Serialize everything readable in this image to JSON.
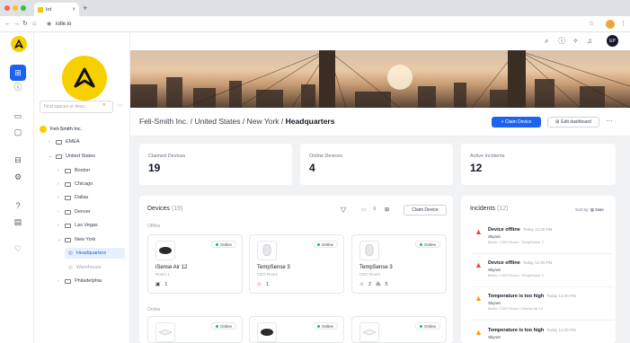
{
  "browser": {
    "tab_title": "Iot",
    "tab_close": "×",
    "new_tab": "+",
    "url": "iotle.io"
  },
  "topbar": {
    "avatar_initials": "EP"
  },
  "tree": {
    "search_placeholder": "Find spaces or devic...",
    "root": "Feli-Smith Inc.",
    "items": [
      {
        "label": "EMEA",
        "level": 1
      },
      {
        "label": "United States",
        "level": 1
      },
      {
        "label": "Boston",
        "level": 2
      },
      {
        "label": "Chicago",
        "level": 2
      },
      {
        "label": "Dallas",
        "level": 2
      },
      {
        "label": "Denver",
        "level": 2
      },
      {
        "label": "Las Vegas",
        "level": 2
      },
      {
        "label": "New York",
        "level": 2
      },
      {
        "label": "Headquarters",
        "level": 3
      },
      {
        "label": "Warehouse",
        "level": 3
      },
      {
        "label": "Philadelphia",
        "level": 2
      }
    ]
  },
  "header": {
    "breadcrumb_1": "Feli-Smith Inc.",
    "breadcrumb_2": "United States",
    "breadcrumb_3": "New York",
    "breadcrumb_current": "Headquarters",
    "separator": "/",
    "claim_button": "+ Claim Device",
    "edit_button": "Edit dashboard"
  },
  "stats": [
    {
      "label": "Claimed Devices",
      "value": "19"
    },
    {
      "label": "Online Devices",
      "value": "4"
    },
    {
      "label": "Active Incidents",
      "value": "12"
    }
  ],
  "devices": {
    "title": "Devices",
    "count": "(19)",
    "claim_button": "Claim Device",
    "offline_label": "Offline",
    "online_label": "Online",
    "cards": [
      {
        "status": "Online",
        "name": "iSense Air 12",
        "location": "Room 1",
        "foot1": "1",
        "foot2": ""
      },
      {
        "status": "Online",
        "name": "TempSense 3",
        "location": "CEO Room",
        "foot1": "1",
        "foot2": ""
      },
      {
        "status": "Online",
        "name": "TempSense 3",
        "location": "CEO Room",
        "foot1": "2",
        "foot2": "5"
      }
    ],
    "online_cards": [
      {
        "status": "Online"
      },
      {
        "status": "Online"
      },
      {
        "status": "Online"
      }
    ]
  },
  "incidents": {
    "title": "Incidents",
    "count": "(12)",
    "sort_label": "Sort by:",
    "sort_value": "Date",
    "items": [
      {
        "title": "Device offline",
        "time": "Today 12:40 PM",
        "source": "Skynet",
        "path": "Berlin / CEO Room / TempSense 3",
        "severity": "critical"
      },
      {
        "title": "Device offline",
        "time": "Today 12:40 PM",
        "source": "Skynet",
        "path": "Berlin / CEO Room / TempSense 3",
        "severity": "critical"
      },
      {
        "title": "Temperature is too high",
        "time": "Today 12:40 PM",
        "source": "Skynet",
        "path": "Berlin / CEO Room / iSense Air 12",
        "severity": "warning"
      },
      {
        "title": "Temperature is too high",
        "time": "Today 12:40 PM",
        "source": "Skynet",
        "path": "",
        "severity": "warning"
      }
    ]
  },
  "colors": {
    "accent": "#1d62f0",
    "brand": "#f7d000",
    "critical": "#ef4444",
    "warning": "#f59e0b",
    "online": "#10b981"
  },
  "icons": [
    "logo-icon",
    "dashboard-icon",
    "alert-icon",
    "chat-icon",
    "folder-icon",
    "box-icon",
    "settings-icon",
    "help-icon",
    "message-icon",
    "bulb-icon"
  ]
}
